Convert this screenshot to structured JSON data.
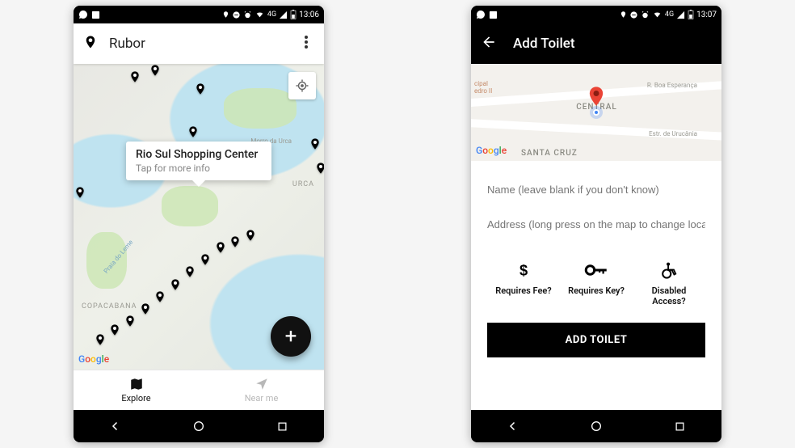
{
  "left": {
    "statusbar": {
      "network": "4G",
      "time": "13:06"
    },
    "appbar": {
      "title": "Rubor"
    },
    "map": {
      "attribution": "Google",
      "info_window": {
        "title": "Rio Sul Shopping Center",
        "subtitle": "Tap for more info"
      },
      "labels": {
        "copacabana": "COPACABANA",
        "urca": "URCA",
        "leme": "Praia do Leme",
        "morro": "Morro da Urca"
      }
    },
    "fab": {
      "icon_label": "+"
    },
    "tabs": {
      "explore": "Explore",
      "near_me": "Near me"
    }
  },
  "right": {
    "statusbar": {
      "network": "4G",
      "time": "13:07"
    },
    "appbar": {
      "title": "Add Toilet"
    },
    "map": {
      "attribution": "Google",
      "districts": {
        "central": "CENTRAL",
        "santacruz": "SANTA CRUZ"
      },
      "roads": {
        "boa": "R. Boa Esperança",
        "uru": "Estr. de Urucânia"
      },
      "landmark": "cipal\nedro II"
    },
    "form": {
      "name_placeholder": "Name (leave blank if you don't know)",
      "address_placeholder": "Address (long press on the map to change location)",
      "toggles": {
        "fee": "Requires Fee?",
        "key": "Requires Key?",
        "access": "Disabled Access?"
      },
      "submit": "ADD TOILET"
    }
  }
}
